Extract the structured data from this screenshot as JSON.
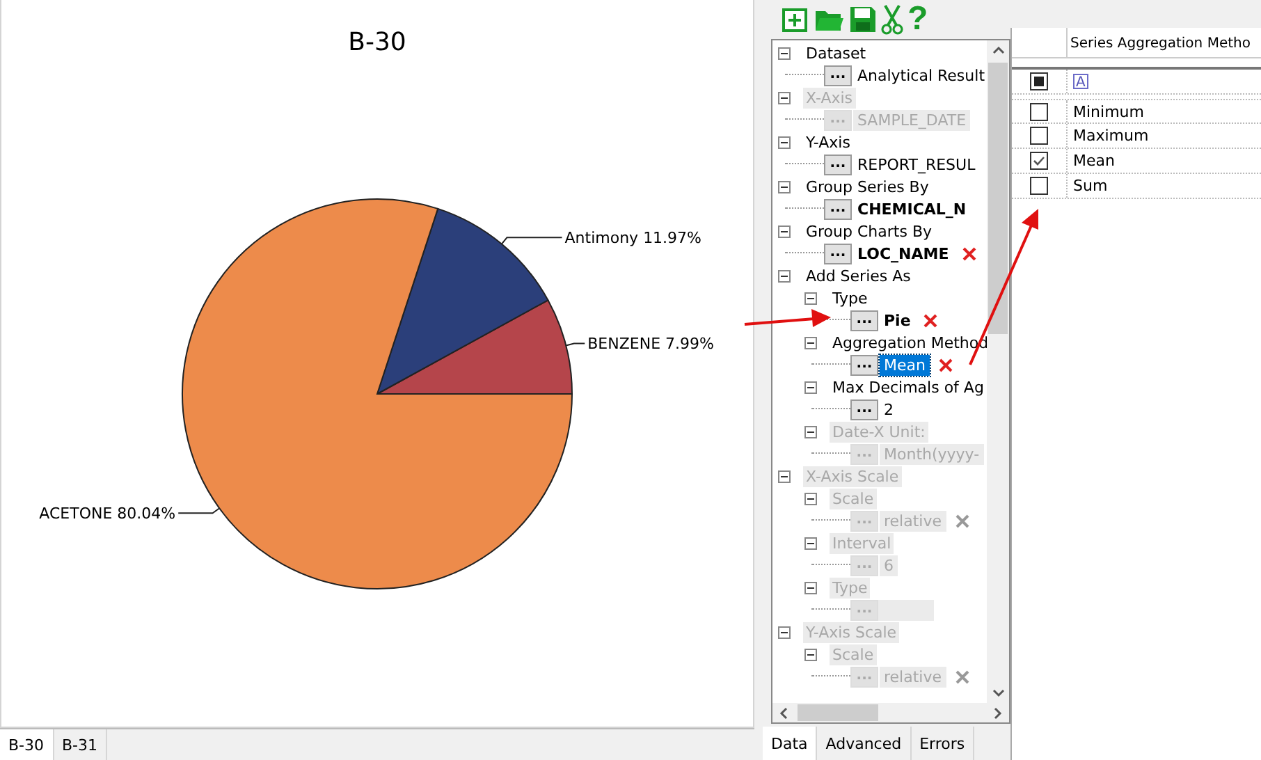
{
  "chart_panel": {
    "chart_data": {
      "type": "pie",
      "title": "B-30",
      "categories": [
        "BENZENE",
        "Antimony",
        "ACETONE"
      ],
      "values": [
        7.99,
        11.97,
        80.04
      ],
      "colors": [
        "#b5454b",
        "#2b3f7a",
        "#ed8b4b"
      ],
      "value_labels": [
        "7.99%",
        "11.97%",
        "80.04%"
      ]
    },
    "tabs": [
      {
        "label": "B-30",
        "selected": true
      },
      {
        "label": "B-31",
        "selected": false
      }
    ]
  },
  "toolbar": [
    {
      "kind": "new"
    },
    {
      "kind": "open"
    },
    {
      "kind": "save"
    },
    {
      "kind": "cut"
    },
    {
      "kind": "help",
      "glyph": "?"
    }
  ],
  "tree": {
    "items": [
      {
        "label": "Dataset",
        "disabled": false,
        "expanded": true,
        "children": [
          {
            "kind": "value",
            "button": "...",
            "value": "Analytical Result",
            "bold": false,
            "selected": false,
            "disabled": false,
            "remove": false
          }
        ]
      },
      {
        "label": "X-Axis",
        "disabled": true,
        "expanded": true,
        "children": [
          {
            "kind": "value",
            "button": "...",
            "value": "SAMPLE_DATE",
            "bold": false,
            "selected": false,
            "disabled": true,
            "remove": false
          }
        ]
      },
      {
        "label": "Y-Axis",
        "disabled": false,
        "expanded": true,
        "children": [
          {
            "kind": "value",
            "button": "...",
            "value": "REPORT_RESUL",
            "bold": false,
            "selected": false,
            "disabled": false,
            "remove": false
          }
        ]
      },
      {
        "label": "Group Series By",
        "disabled": false,
        "expanded": true,
        "children": [
          {
            "kind": "value",
            "button": "...",
            "value": "CHEMICAL_N",
            "bold": true,
            "selected": false,
            "disabled": false,
            "remove": false
          }
        ]
      },
      {
        "label": "Group Charts By",
        "disabled": false,
        "expanded": true,
        "children": [
          {
            "kind": "value",
            "button": "...",
            "value": "LOC_NAME",
            "bold": true,
            "selected": false,
            "disabled": false,
            "remove": true
          }
        ]
      },
      {
        "label": "Add Series As",
        "disabled": false,
        "expanded": true,
        "children": [
          {
            "kind": "node",
            "label": "Type",
            "disabled": false,
            "expanded": true,
            "children": [
              {
                "kind": "value",
                "button": "...",
                "value": "Pie",
                "bold": true,
                "selected": false,
                "disabled": false,
                "remove": true
              }
            ]
          },
          {
            "kind": "node",
            "label": "Aggregation Method",
            "disabled": false,
            "expanded": true,
            "children": [
              {
                "kind": "value",
                "button": "...",
                "value": "Mean",
                "bold": false,
                "selected": true,
                "disabled": false,
                "remove": true
              }
            ]
          },
          {
            "kind": "node",
            "label": "Max Decimals of Ag",
            "disabled": false,
            "expanded": true,
            "children": [
              {
                "kind": "value",
                "button": "...",
                "value": "2",
                "bold": false,
                "selected": false,
                "disabled": false,
                "remove": false
              }
            ]
          },
          {
            "kind": "node",
            "label": "Date-X Unit:",
            "disabled": true,
            "expanded": true,
            "children": [
              {
                "kind": "value",
                "button": "...",
                "value": "Month(yyyy-",
                "bold": false,
                "selected": false,
                "disabled": true,
                "remove": false
              }
            ]
          }
        ]
      },
      {
        "label": "X-Axis Scale",
        "disabled": true,
        "expanded": true,
        "children": [
          {
            "kind": "node",
            "label": "Scale",
            "disabled": true,
            "expanded": true,
            "children": [
              {
                "kind": "value",
                "button": "...",
                "value": "relative",
                "bold": false,
                "selected": false,
                "disabled": true,
                "remove": true
              }
            ]
          },
          {
            "kind": "node",
            "label": "Interval",
            "disabled": true,
            "expanded": true,
            "children": [
              {
                "kind": "value",
                "button": "...",
                "value": "6",
                "bold": false,
                "selected": false,
                "disabled": true,
                "remove": false
              }
            ]
          },
          {
            "kind": "node",
            "label": "Type",
            "disabled": true,
            "expanded": true,
            "children": [
              {
                "kind": "value",
                "button": "...",
                "disabled": true
              }
            ]
          }
        ]
      },
      {
        "label": "Y-Axis Scale",
        "disabled": true,
        "expanded": true,
        "children": [
          {
            "kind": "node",
            "label": "Scale",
            "disabled": true,
            "expanded": true,
            "children": [
              {
                "kind": "value",
                "button": "...",
                "value": "relative",
                "bold": false,
                "selected": false,
                "disabled": true,
                "remove": true
              }
            ]
          }
        ]
      }
    ]
  },
  "panel_tabs": [
    {
      "label": "Data",
      "selected": true
    },
    {
      "label": "Advanced",
      "selected": false
    },
    {
      "label": "Errors",
      "selected": false
    }
  ],
  "grid": {
    "column": "Series Aggregation Metho",
    "filter_partial": true,
    "filter_operator": "A",
    "rows": [
      {
        "label": "Minimum",
        "checked": false
      },
      {
        "label": "Maximum",
        "checked": false
      },
      {
        "label": "Mean",
        "checked": true
      },
      {
        "label": "Sum",
        "checked": false
      }
    ]
  }
}
